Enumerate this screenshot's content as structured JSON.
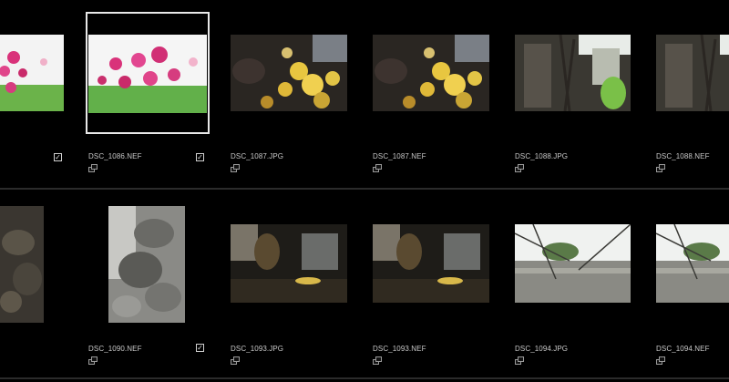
{
  "filmstrip": {
    "rows": [
      {
        "items": [
          {
            "filename": "",
            "checked": true,
            "selected": false,
            "photo": "pink-flowers"
          },
          {
            "filename": "DSC_1086.NEF",
            "checked": true,
            "selected": true,
            "photo": "pink-flowers"
          },
          {
            "filename": "DSC_1087.JPG",
            "checked": false,
            "selected": false,
            "photo": "yellow-pansies"
          },
          {
            "filename": "DSC_1087.NEF",
            "checked": false,
            "selected": false,
            "photo": "yellow-pansies"
          },
          {
            "filename": "DSC_1088.JPG",
            "checked": false,
            "selected": false,
            "photo": "garden-plant"
          },
          {
            "filename": "DSC_1088.NEF",
            "checked": false,
            "selected": false,
            "photo": "garden-plant"
          }
        ]
      },
      {
        "items": [
          {
            "filename": "",
            "checked": false,
            "selected": false,
            "photo": "dark-leaves"
          },
          {
            "filename": "DSC_1090.NEF",
            "checked": true,
            "selected": false,
            "photo": "bw-leaves"
          },
          {
            "filename": "DSC_1093.JPG",
            "checked": false,
            "selected": false,
            "photo": "dark-garden"
          },
          {
            "filename": "DSC_1093.NEF",
            "checked": false,
            "selected": false,
            "photo": "dark-garden"
          },
          {
            "filename": "DSC_1094.JPG",
            "checked": false,
            "selected": false,
            "photo": "tree-branches"
          },
          {
            "filename": "DSC_1094.NEF",
            "checked": false,
            "selected": false,
            "photo": "tree-branches"
          }
        ]
      }
    ]
  },
  "colors": {
    "background": "#000000",
    "selection": "#e8e8e8",
    "text": "#c8c8c8",
    "divider": "#2b2b2b"
  }
}
